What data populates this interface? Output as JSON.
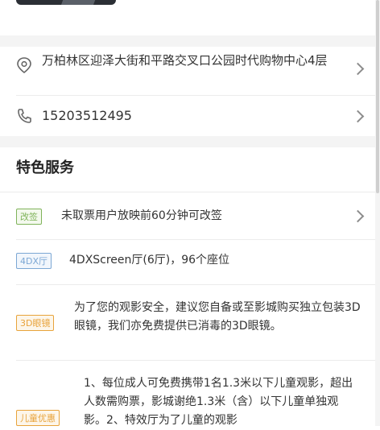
{
  "cinema": {
    "address": "万柏林区迎泽大街和平路交叉口公园时代购物中心4层",
    "phone": "15203512495"
  },
  "features": {
    "title": "特色服务",
    "items": [
      {
        "badge": "改签",
        "text": "未取票用户放映前60分钟可改签",
        "color": "#7fb35a"
      },
      {
        "badge": "4DX厅",
        "text": "4DXScreen厅(6厅)，96个座位",
        "color": "#7ca7d4"
      },
      {
        "badge": "3D眼镜",
        "text": "为了您的观影安全，建议您自备或至影城购买独立包装3D眼镜，我们亦免费提供已消毒的3D眼镜。",
        "color": "#e8a33b"
      },
      {
        "badge": "儿童优惠",
        "text": "1、每位成人可免费携带1名1.3米以下儿童观影，超出人数需购票，影城谢绝1.3米（含）以下儿童单独观影。2、特效厅为了儿童的观影",
        "color": "#e8a33b"
      }
    ]
  },
  "icons": {
    "address": "location-pin-icon",
    "phone": "phone-icon",
    "more": "chevron-right-icon"
  }
}
